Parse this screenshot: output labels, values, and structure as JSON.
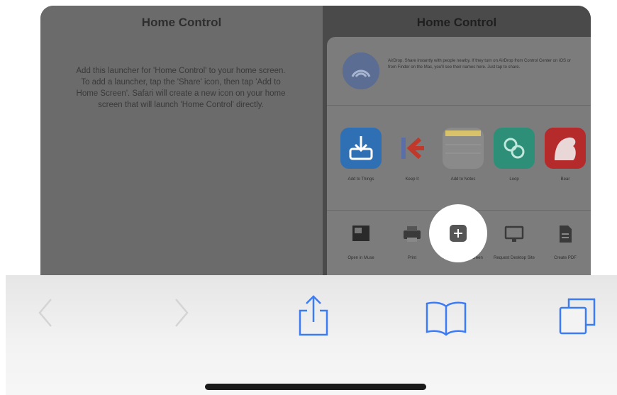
{
  "left_pane": {
    "title": "Home Control",
    "description": "Add this launcher for 'Home Control' to your home screen. To add a launcher, tap the 'Share' icon, then tap 'Add to Home Screen'. Safari will create a new icon on your home screen that will launch 'Home Control' directly."
  },
  "right_pane": {
    "title": "Home Control",
    "airdrop_text": "AirDrop. Share instantly with people nearby. If they turn on AirDrop from Control Center on iOS or from Finder on the Mac, you'll see their names here. Just tap to share.",
    "apps": [
      {
        "label": "Add to Things",
        "icon": "download-tray-icon",
        "color": "#2f6fb3"
      },
      {
        "label": "Keep It",
        "icon": "k-arrow-icon",
        "color": "#ffffff"
      },
      {
        "label": "Add to Notes",
        "icon": "notes-icon",
        "color": "#d9c36a"
      },
      {
        "label": "Loop",
        "icon": "link-circles-icon",
        "color": "#2e8f78"
      },
      {
        "label": "Bear",
        "icon": "bear-icon",
        "color": "#b52a2a"
      }
    ],
    "actions": [
      {
        "label": "Open in Muse",
        "icon": "screen-icon"
      },
      {
        "label": "Print",
        "icon": "printer-icon"
      },
      {
        "label": "Add to Home Screen",
        "icon": "add-square-icon"
      },
      {
        "label": "Request Desktop Site",
        "icon": "desktop-icon"
      },
      {
        "label": "Create PDF",
        "icon": "document-icon"
      }
    ]
  },
  "toolbar": {
    "back": "back-chevron-icon",
    "forward": "forward-chevron-icon",
    "share": "share-icon",
    "bookmarks": "bookmarks-book-icon",
    "tabs": "tabs-icon",
    "accent": "#3b7bf5"
  }
}
